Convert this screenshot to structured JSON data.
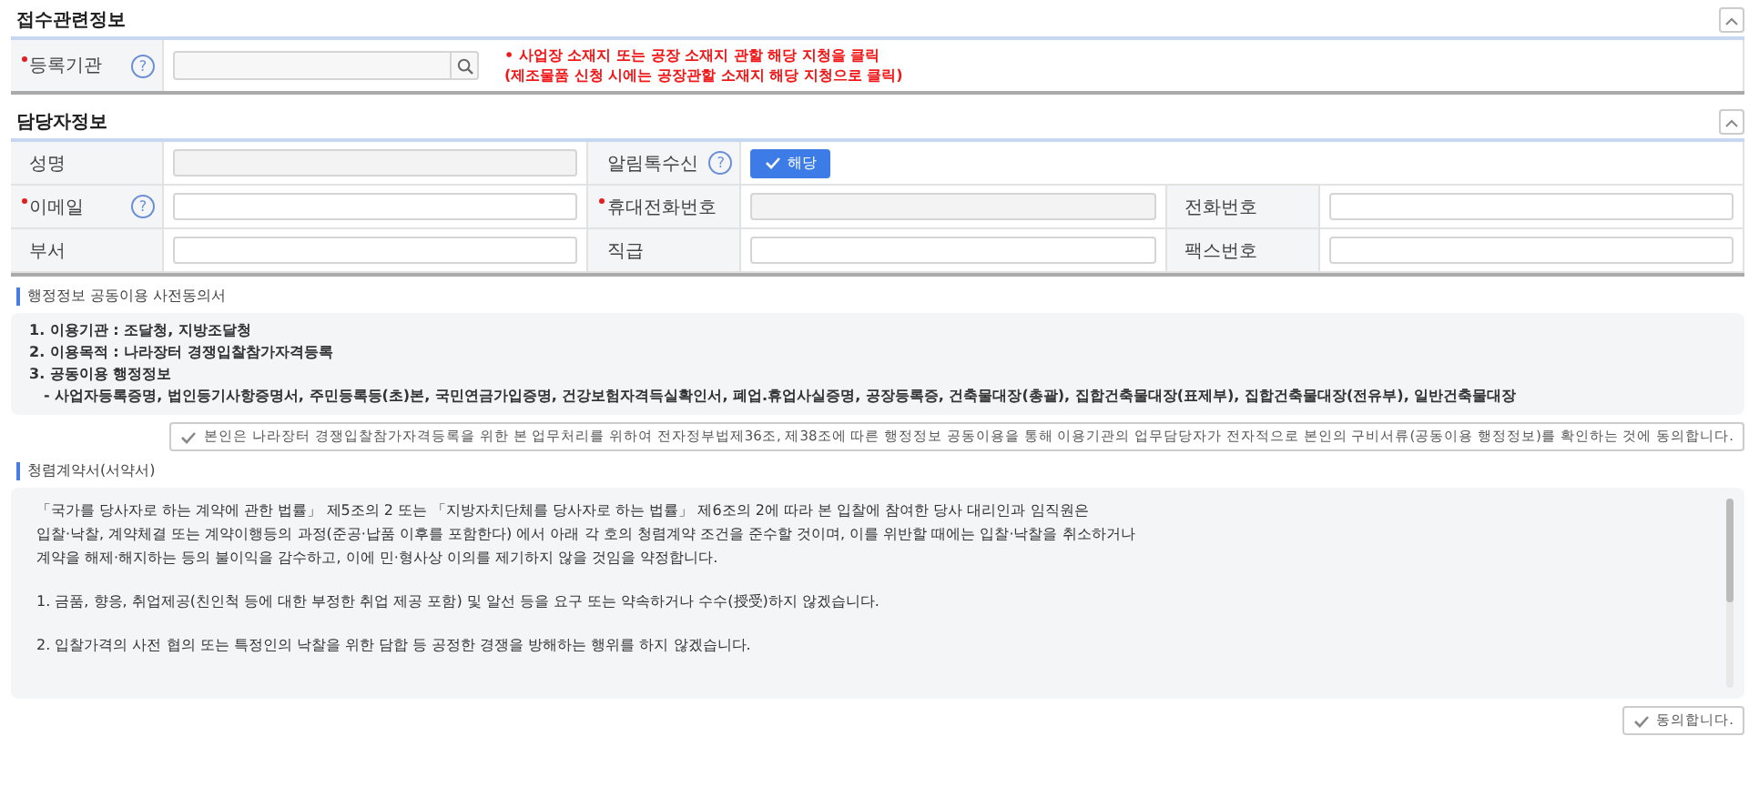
{
  "registration": {
    "title": "접수관련정보",
    "expanded": true,
    "field": {
      "label": "등록기관",
      "required": true,
      "help": "?"
    },
    "notes": [
      "• 사업장 소재지 또는 공장 소재지 관할 해당 지청을 클릭",
      "(제조물품 신청 시에는 공장관할 소재지 해당 지청으로 클릭)"
    ]
  },
  "contact": {
    "title": "담당자정보",
    "expanded": true,
    "rows": [
      [
        {
          "label": "성명",
          "required": false,
          "kind": "input",
          "disabled": true
        },
        {
          "label": "알림톡수신",
          "required": false,
          "help": "?",
          "kind": "toggle",
          "checked": true,
          "text": "해당"
        }
      ],
      [
        {
          "label": "이메일",
          "required": true,
          "help": "?",
          "kind": "input",
          "disabled": false
        },
        {
          "label": "휴대전화번호",
          "required": true,
          "kind": "input",
          "disabled": true
        },
        {
          "label": "전화번호",
          "required": false,
          "kind": "input",
          "disabled": false
        }
      ],
      [
        {
          "label": "부서",
          "required": false,
          "kind": "input",
          "disabled": false
        },
        {
          "label": "직급",
          "required": false,
          "kind": "input",
          "disabled": false
        },
        {
          "label": "팩스번호",
          "required": false,
          "kind": "input",
          "disabled": false
        }
      ]
    ]
  },
  "consent": {
    "title": "행정정보 공동이용 사전동의서",
    "lines": [
      "1. 이용기관 : 조달청, 지방조달청",
      "2. 이용목적 : 나라장터 경쟁입찰참가자격등록",
      "3. 공동이용 행정정보",
      "- 사업자등록증명, 법인등기사항증명서, 주민등록등(초)본, 국민연금가입증명, 건강보험자격득실확인서, 폐업.휴업사실증명, 공장등록증, 건축물대장(총괄), 집합건축물대장(표제부), 집합건축물대장(전유부), 일반건축물대장"
    ],
    "agree": {
      "text": "본인은 나라장터 경쟁입찰참가자격등록을 위한 본 업무처리를 위하여 전자정부법제36조, 제38조에 따른 행정정보 공동이용을 통해 이용기관의 업무담당자가 전자적으로 본인의 구비서류(공동이용 행정정보)를 확인하는 것에 동의합니다.",
      "checked": false
    }
  },
  "pledge": {
    "title": "청렴계약서(서약서)",
    "paragraphs": [
      "「국가를 당사자로 하는 계약에 관한 법률」 제5조의 2 또는 「지방자치단체를 당사자로 하는 법률」 제6조의 2에 따라 본 입찰에 참여한 당사 대리인과 임직원은\n입찰·낙찰, 계약체결 또는 계약이행등의 과정(준공·납품 이후를 포함한다) 에서 아래 각 호의 청렴계약 조건을 준수할 것이며, 이를 위반할 때에는 입찰·낙찰을 취소하거나\n계약을 해제·해지하는 등의 불이익을 감수하고, 이에 민·형사상 이의를 제기하지 않을 것임을 약정합니다.",
      "1. 금품, 향응, 취업제공(친인척  등에 대한 부정한 취업 제공 포함) 및 알선 등을 요구 또는 약속하거나 수수(授受)하지 않겠습니다.",
      "2. 입찰가격의 사전 협의 또는 특정인의 낙찰을 위한 담합 등 공정한 경쟁을 방해하는 행위를 하지 않겠습니다."
    ],
    "agree": {
      "text": "동의합니다.",
      "checked": false
    }
  }
}
